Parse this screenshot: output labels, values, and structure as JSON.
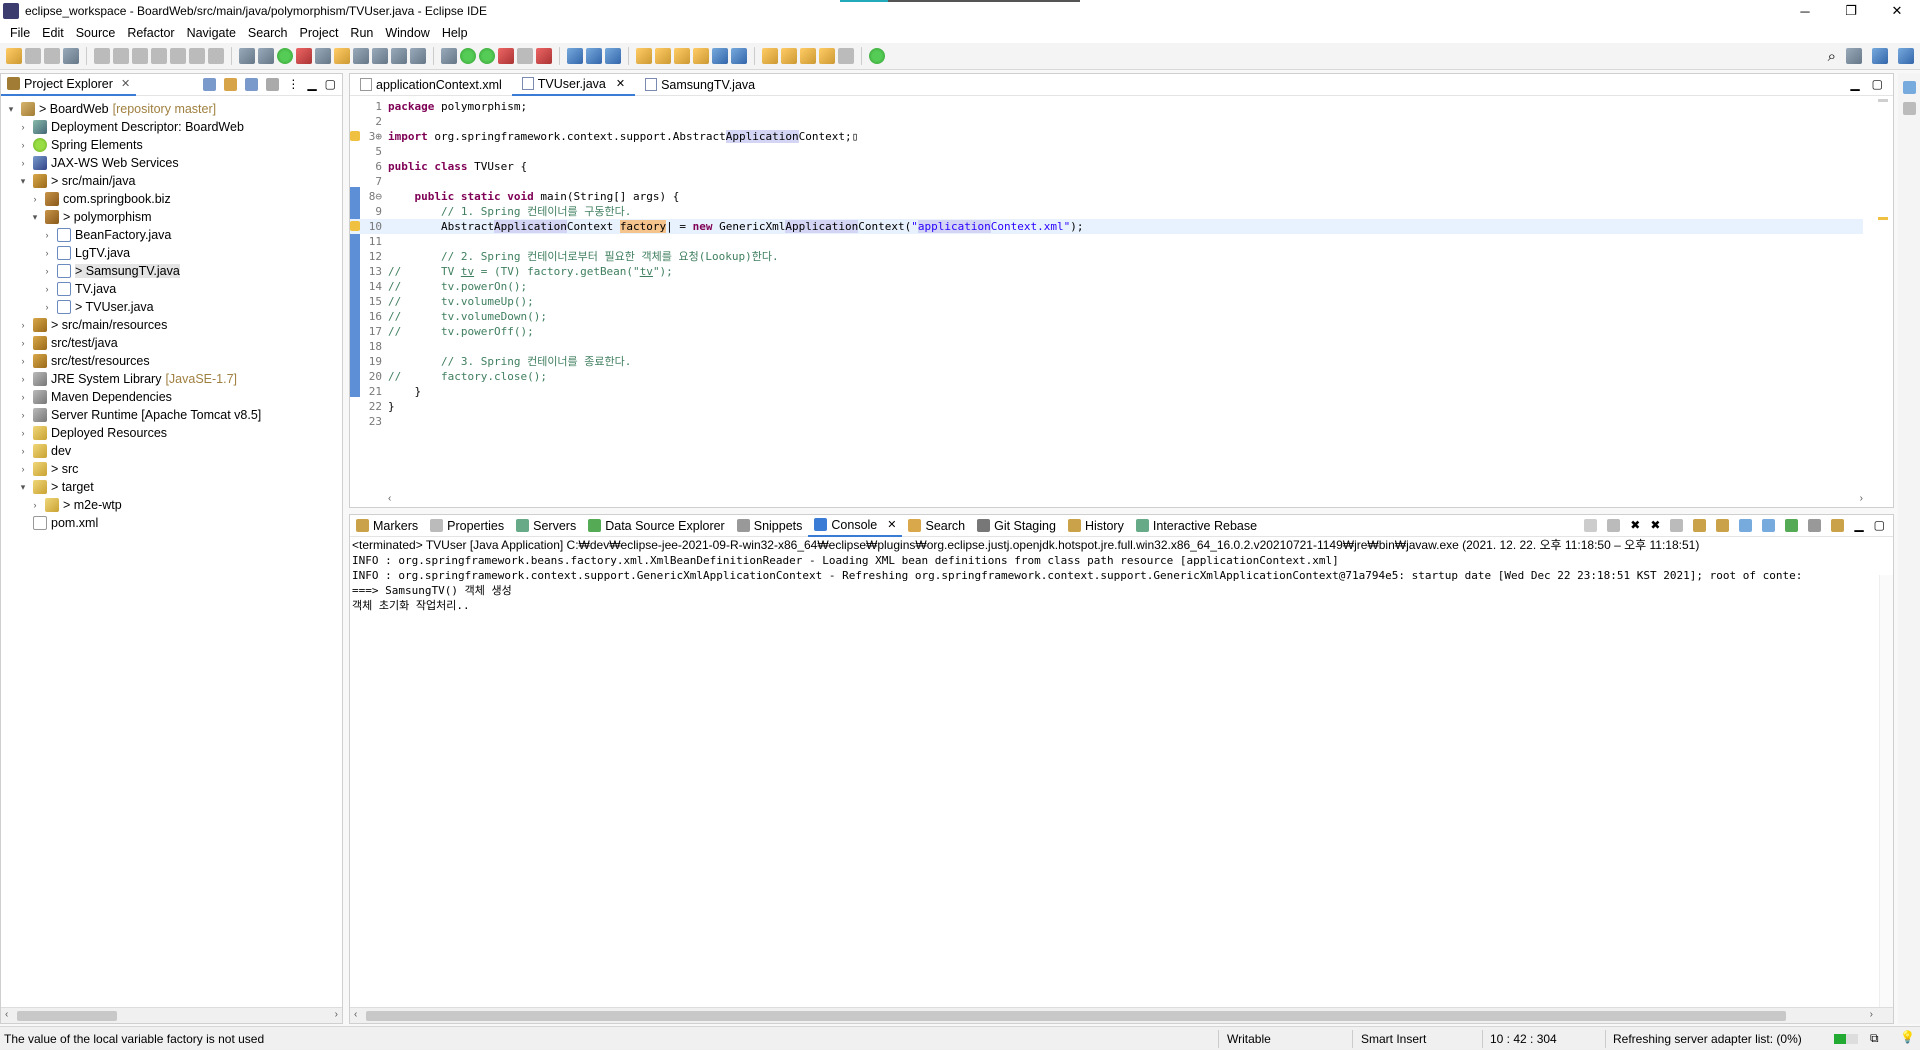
{
  "window": {
    "title": "eclipse_workspace - BoardWeb/src/main/java/polymorphism/TVUser.java - Eclipse IDE",
    "controls": [
      "─",
      "❐",
      "✕"
    ]
  },
  "menu": [
    "File",
    "Edit",
    "Source",
    "Refactor",
    "Navigate",
    "Search",
    "Project",
    "Run",
    "Window",
    "Help"
  ],
  "project_explorer": {
    "title": "Project Explorer",
    "items": [
      {
        "label": "> BoardWeb",
        "deco": "[repository master]",
        "arrow": "▾",
        "icon": "project-icon"
      },
      {
        "label": "Deployment Descriptor: BoardWeb",
        "deco": "",
        "arrow": "›",
        "icon": "descriptor-icon"
      },
      {
        "label": "Spring Elements",
        "deco": "",
        "arrow": "›",
        "icon": "spring-icon"
      },
      {
        "label": "JAX-WS Web Services",
        "deco": "",
        "arrow": "›",
        "icon": "webservice-icon"
      },
      {
        "label": "> src/main/java",
        "deco": "",
        "arrow": "▾",
        "icon": "source-folder-icon"
      },
      {
        "label": "com.springbook.biz",
        "deco": "",
        "arrow": "›",
        "icon": "package-icon"
      },
      {
        "label": "> polymorphism",
        "deco": "",
        "arrow": "▾",
        "icon": "package-icon"
      },
      {
        "label": "BeanFactory.java",
        "deco": "",
        "arrow": "›",
        "icon": "java-file-icon"
      },
      {
        "label": "LgTV.java",
        "deco": "",
        "arrow": "›",
        "icon": "java-file-icon"
      },
      {
        "label": "> SamsungTV.java",
        "deco": "",
        "arrow": "›",
        "icon": "java-file-icon"
      },
      {
        "label": "TV.java",
        "deco": "",
        "arrow": "›",
        "icon": "java-file-icon"
      },
      {
        "label": "> TVUser.java",
        "deco": "",
        "arrow": "›",
        "icon": "java-file-icon"
      },
      {
        "label": "> src/main/resources",
        "deco": "",
        "arrow": "›",
        "icon": "source-folder-icon"
      },
      {
        "label": "src/test/java",
        "deco": "",
        "arrow": "›",
        "icon": "source-folder-icon"
      },
      {
        "label": "src/test/resources",
        "deco": "",
        "arrow": "›",
        "icon": "source-folder-icon"
      },
      {
        "label": "JRE System Library",
        "deco": "[JavaSE-1.7]",
        "arrow": "›",
        "icon": "library-icon"
      },
      {
        "label": "Maven Dependencies",
        "deco": "",
        "arrow": "›",
        "icon": "library-icon"
      },
      {
        "label": "Server Runtime [Apache Tomcat v8.5]",
        "deco": "",
        "arrow": "›",
        "icon": "library-icon"
      },
      {
        "label": "Deployed Resources",
        "deco": "",
        "arrow": "›",
        "icon": "folder-icon"
      },
      {
        "label": "dev",
        "deco": "",
        "arrow": "›",
        "icon": "folder-icon"
      },
      {
        "label": "> src",
        "deco": "",
        "arrow": "›",
        "icon": "folder-icon"
      },
      {
        "label": "> target",
        "deco": "",
        "arrow": "▾",
        "icon": "folder-icon"
      },
      {
        "label": "> m2e-wtp",
        "deco": "",
        "arrow": "›",
        "icon": "folder-icon"
      },
      {
        "label": "pom.xml",
        "deco": "",
        "arrow": "",
        "icon": "xml-file-icon"
      }
    ]
  },
  "editor": {
    "tabs": [
      {
        "label": "applicationContext.xml"
      },
      {
        "label": "TVUser.java"
      },
      {
        "label": "SamsungTV.java"
      }
    ],
    "lines": [
      {
        "n": "1",
        "html": "<span class=\"kw\">package</span> polymorphism;"
      },
      {
        "n": "2",
        "html": ""
      },
      {
        "n": "3⊕",
        "html": "<span class=\"kw\">import</span> org.springframework.context.support.Abstract<span class=\"hl\">Application</span>Context;▯"
      },
      {
        "n": "5",
        "html": ""
      },
      {
        "n": "6",
        "html": "<span class=\"kw\">public class</span> TVUser {"
      },
      {
        "n": "7",
        "html": ""
      },
      {
        "n": "8⊖",
        "html": "    <span class=\"kw\">public static void</span> main(String[] args) {"
      },
      {
        "n": "9",
        "html": "        <span class=\"cm\">// 1. Spring 컨테이너를 구동한다.</span>"
      },
      {
        "n": "10",
        "html": "        Abstract<span class=\"hl\">Application</span>Context <span class=\"occ\">factory</span>| = <span class=\"kw\">new</span> GenericXml<span class=\"hl\">Application</span>Context(<span class=\"st\">\"<span class=\"hl\">application</span>Context.xml\"</span>);"
      },
      {
        "n": "11",
        "html": ""
      },
      {
        "n": "12",
        "html": "        <span class=\"cm\">// 2. Spring 컨테이너로부터 필요한 객체를 요청(Lookup)한다.</span>"
      },
      {
        "n": "13",
        "html": "<span class=\"cm\">//      TV <u>tv</u> = (TV) factory.getBean(\"<u>tv</u>\");</span>"
      },
      {
        "n": "14",
        "html": "<span class=\"cm\">//      tv.powerOn();</span>"
      },
      {
        "n": "15",
        "html": "<span class=\"cm\">//      tv.volumeUp();</span>"
      },
      {
        "n": "16",
        "html": "<span class=\"cm\">//      tv.volumeDown();</span>"
      },
      {
        "n": "17",
        "html": "<span class=\"cm\">//      tv.powerOff();</span>"
      },
      {
        "n": "18",
        "html": ""
      },
      {
        "n": "19",
        "html": "        <span class=\"cm\">// 3. Spring 컨테이너를 종료한다.</span>"
      },
      {
        "n": "20",
        "html": "<span class=\"cm\">//      factory.close();</span>"
      },
      {
        "n": "21",
        "html": "    }"
      },
      {
        "n": "22",
        "html": "}"
      },
      {
        "n": "23",
        "html": ""
      }
    ]
  },
  "bottom_panel": {
    "tabs": [
      {
        "label": "Markers"
      },
      {
        "label": "Properties"
      },
      {
        "label": "Servers"
      },
      {
        "label": "Data Source Explorer"
      },
      {
        "label": "Snippets"
      },
      {
        "label": "Console"
      },
      {
        "label": "Search"
      },
      {
        "label": "Git Staging"
      },
      {
        "label": "History"
      },
      {
        "label": "Interactive Rebase"
      }
    ],
    "console_header": "<terminated> TVUser [Java Application] C:₩dev₩eclipse-jee-2021-09-R-win32-x86_64₩eclipse₩plugins₩org.eclipse.justj.openjdk.hotspot.jre.full.win32.x86_64_16.0.2.v20210721-1149₩jre₩bin₩javaw.exe  (2021. 12. 22. 오후 11:18:50 – 오후 11:18:51)",
    "console_lines": [
      "INFO : org.springframework.beans.factory.xml.XmlBeanDefinitionReader - Loading XML bean definitions from class path resource [applicationContext.xml]",
      "INFO : org.springframework.context.support.GenericXmlApplicationContext - Refreshing org.springframework.context.support.GenericXmlApplicationContext@71a794e5: startup date [Wed Dec 22 23:18:51 KST 2021]; root of conte:",
      "===> SamsungTV() 객체 생성",
      "객체 초기화 작업처리.."
    ]
  },
  "status": {
    "message": "The value of the local variable factory is not used",
    "writable": "Writable",
    "insert_mode": "Smart Insert",
    "position": "10 : 42 : 304",
    "job": "Refreshing server adapter list: (0%)"
  }
}
